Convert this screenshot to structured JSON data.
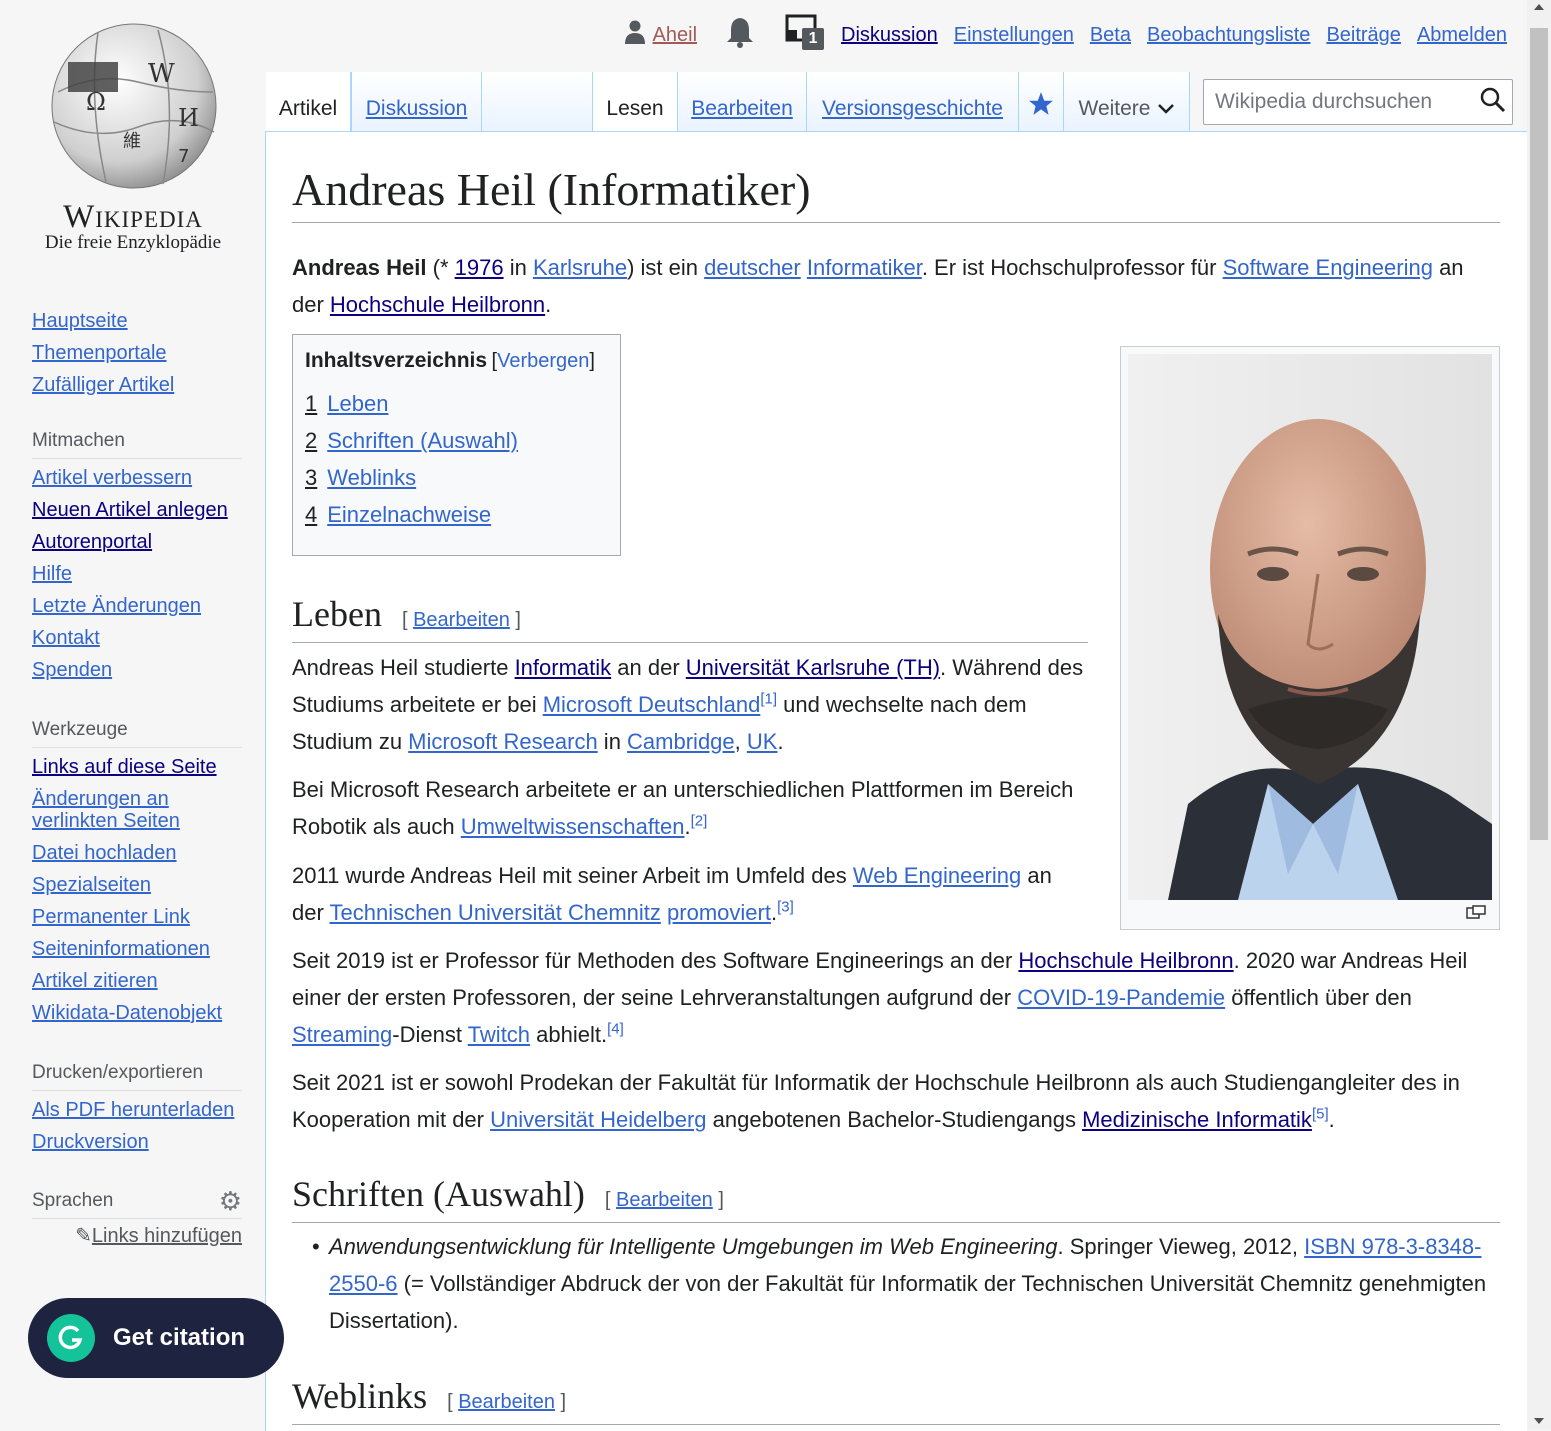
{
  "logo": {
    "wordmark": "Wikipedia",
    "tagline": "Die freie Enzyklopädie"
  },
  "nav_main": [
    "Hauptseite",
    "Themenportale",
    "Zufälliger Artikel"
  ],
  "mitmachen": {
    "heading": "Mitmachen",
    "items": [
      "Artikel verbessern",
      "Neuen Artikel anlegen",
      "Autorenportal",
      "Hilfe",
      "Letzte Änderungen",
      "Kontakt",
      "Spenden"
    ]
  },
  "werkzeuge": {
    "heading": "Werkzeuge",
    "items": [
      "Links auf diese Seite",
      "Änderungen an verlinkten Seiten",
      "Datei hochladen",
      "Spezialseiten",
      "Permanenter Link",
      "Seiteninformationen",
      "Artikel zitieren",
      "Wikidata-Datenobjekt"
    ]
  },
  "drucken": {
    "heading": "Drucken/exportieren",
    "items": [
      "Als PDF herunterladen",
      "Druckversion"
    ]
  },
  "sprachen": {
    "heading": "Sprachen",
    "add_links": "Links hinzufügen"
  },
  "personal": {
    "user": "Aheil",
    "notice_count": "1",
    "links": [
      "Diskussion",
      "Einstellungen",
      "Beta",
      "Beobachtungsliste",
      "Beiträge",
      "Abmelden"
    ]
  },
  "tabs": {
    "artikel": "Artikel",
    "diskussion": "Diskussion",
    "lesen": "Lesen",
    "bearbeiten": "Bearbeiten",
    "versionen": "Versionsgeschichte",
    "weitere": "Weitere"
  },
  "search": {
    "placeholder": "Wikipedia durchsuchen"
  },
  "article": {
    "title": "Andreas Heil (Informatiker)",
    "intro": {
      "name": "Andreas Heil",
      "t1": " (* ",
      "year": "1976",
      "t2": " in ",
      "city": "Karlsruhe",
      "t3": ") ist ein ",
      "nat": "deutscher",
      "t4": " ",
      "job": "Informatiker",
      "t5": ". Er ist Hochschulprofessor für ",
      "field": "Software Engineering",
      "t6": " an der ",
      "uni": "Hochschule Heilbronn",
      "t7": "."
    },
    "toc": {
      "title": "Inhaltsverzeichnis",
      "toggle": "Verbergen",
      "items": [
        {
          "n": "1",
          "label": "Leben"
        },
        {
          "n": "2",
          "label": "Schriften (Auswahl)"
        },
        {
          "n": "3",
          "label": "Weblinks"
        },
        {
          "n": "4",
          "label": "Einzelnachweise"
        }
      ]
    },
    "sections": {
      "leben": "Leben",
      "schriften": "Schriften (Auswahl)",
      "weblinks": "Weblinks",
      "edit": "Bearbeiten"
    },
    "leben": {
      "p1": {
        "t1": "Andreas Heil studierte ",
        "l1": "Informatik",
        "t2": " an der ",
        "l2": "Universität Karlsruhe (TH)",
        "t3": ". Während des Studiums arbeitete er bei ",
        "l3": "Microsoft Deutschland",
        "r1": "[1]",
        "t4": " und wechselte nach dem Studium zu ",
        "l4": "Microsoft Research",
        "t5": " in ",
        "l5": "Cambridge",
        "t6": ", ",
        "l6": "UK",
        "t7": "."
      },
      "p2": {
        "t1": "Bei Microsoft Research arbeitete er an unterschiedlichen Plattformen im Bereich Robotik als auch ",
        "l1": "Umweltwissenschaften",
        "t2": ".",
        "r1": "[2]"
      },
      "p3": {
        "t1": "2011 wurde Andreas Heil mit seiner Arbeit im Umfeld des ",
        "l1": "Web Engineering",
        "t2": " an der ",
        "l2": "Technischen Universität Chemnitz",
        "t3": " ",
        "l3": "promoviert",
        "t4": ".",
        "r1": "[3]"
      },
      "p4": {
        "t1": "Seit 2019 ist er Professor für Methoden des Software Engineerings an der ",
        "l1": "Hochschule Heilbronn",
        "t2": ". 2020 war Andreas Heil einer der ersten Professoren, der seine Lehrveranstaltungen aufgrund der ",
        "l2": "COVID-19-Pandemie",
        "t3": " öffentlich über den ",
        "l3": "Streaming",
        "t4": "-Dienst ",
        "l4": "Twitch",
        "t5": " abhielt.",
        "r1": "[4]"
      },
      "p5": {
        "t1": "Seit 2021 ist er sowohl Prodekan der Fakultät für Informatik der Hochschule Heilbronn als auch Studiengangleiter des in Kooperation mit der ",
        "l1": "Universität Heidelberg",
        "t2": " angebotenen Bachelor-Studiengangs ",
        "l2": "Medizinische Informatik",
        "r1": "[5]",
        "t3": "."
      }
    },
    "schriften": {
      "title": "Anwendungsentwicklung für Intelligente Umgebungen im Web Engineering",
      "t1": ". Springer Vieweg, 2012, ",
      "isbn": "ISBN 978-3-8348-2550-6",
      "t2": " (= Vollständiger Abdruck der von der Fakultät für Informatik der Technischen Universität Chemnitz genehmigten Dissertation)."
    }
  },
  "citation_button": "Get citation"
}
